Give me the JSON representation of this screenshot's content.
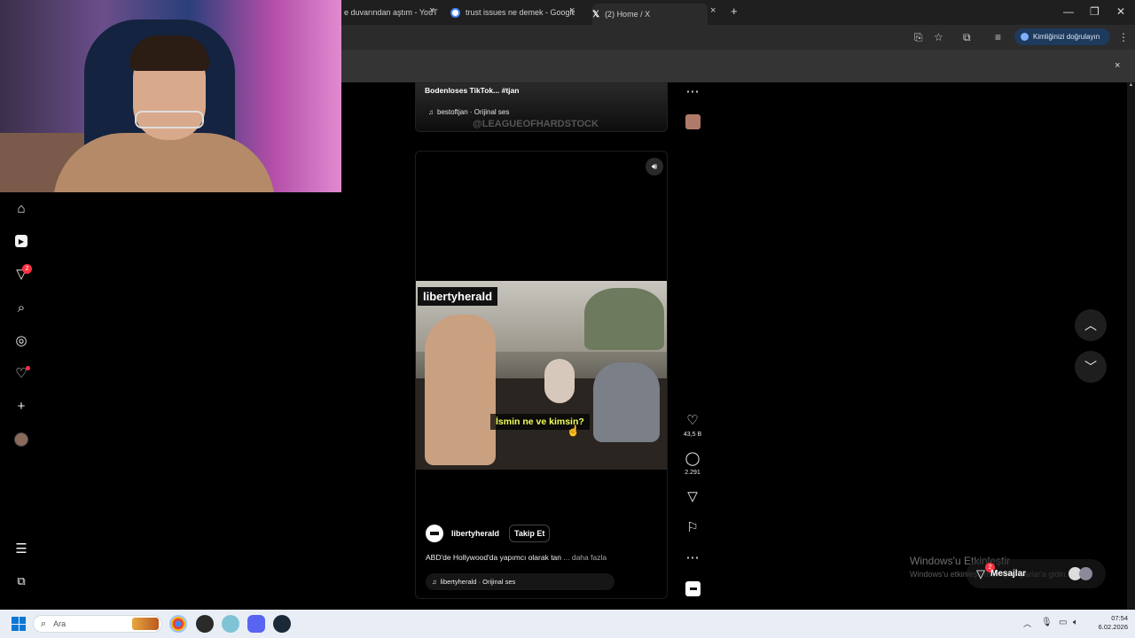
{
  "browser": {
    "tabs": [
      {
        "title": "e duvarından aştım - YouT",
        "close": "×"
      },
      {
        "title": "trust issues ne demek - Google",
        "close": "×"
      },
      {
        "title": "(2) Home / X",
        "close": "×"
      }
    ],
    "new_tab": "+",
    "verify_label": "Kimliğinizi doğrulayın",
    "info_close": "×"
  },
  "nav": {
    "notifications_badge": "2",
    "icons": [
      "home-icon",
      "reels-icon",
      "messages-icon",
      "search-icon",
      "explore-icon",
      "notifications-icon",
      "create-icon",
      "profile-avatar"
    ],
    "more_icon": "menu-icon",
    "also_from_meta_icon": "grid-icon"
  },
  "prev_post": {
    "title": "Bodenloses TikTok... #tjan",
    "audio": "bestoftjan · Orijinal ses",
    "watermark": "@LEAGUEOFHARDSTOCK"
  },
  "post": {
    "video_label": "libertyherald",
    "subtitle": "İsmin ne ve kimsin?",
    "username": "libertyherald",
    "follow": "Takip Et",
    "caption": "ABD'de Hollywood'da yapımcı olarak tan",
    "more": "... daha fazla",
    "audio": "libertyherald · Orijinal ses"
  },
  "actions": {
    "likes": "43,5 B",
    "comments": "2.291"
  },
  "messages": {
    "label": "Mesajlar",
    "badge": "2"
  },
  "watermark": {
    "line1": "Windows'u Etkinleştir",
    "line2": "Windows'u etkinleştirmek için Ayarlar'a gidin."
  },
  "taskbar": {
    "search_placeholder": "Ara",
    "time": "07:54",
    "date": "6.02.2026"
  },
  "colors": {
    "accent_blue": "#1e3a5c",
    "badge_red": "#ff3040",
    "subtitle_yellow": "#f2ff5a"
  }
}
